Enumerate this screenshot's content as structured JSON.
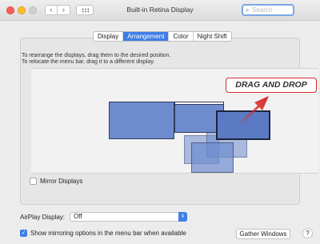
{
  "window": {
    "title": "Built-in Retina Display"
  },
  "toolbar": {
    "back_glyph": "‹",
    "forward_glyph": "›",
    "grid_icon": "grid-icon"
  },
  "search": {
    "placeholder": "Search",
    "icon_glyph": "⌕"
  },
  "tabs": [
    {
      "label": "Display",
      "active": false
    },
    {
      "label": "Arrangement",
      "active": true
    },
    {
      "label": "Color",
      "active": false
    },
    {
      "label": "Night Shift",
      "active": false
    }
  ],
  "instructions": {
    "line1": "To rearrange the displays, drag them to the desired position.",
    "line2": "To relocate the menu bar, drag it to a different display."
  },
  "overlay": {
    "drag_label": "DRAG AND DROP"
  },
  "mirror": {
    "label": "Mirror Displays",
    "checked": false
  },
  "airplay": {
    "label": "AirPlay Display:",
    "value": "Off"
  },
  "show_mirroring": {
    "label": "Show mirroring options in the menu bar when available",
    "checked": true
  },
  "buttons": {
    "gather_windows": "Gather Windows",
    "help": "?"
  },
  "colors": {
    "accent": "#3e7ee6",
    "display_fill": "#6e8ccd",
    "highlight": "#d82a2a"
  }
}
